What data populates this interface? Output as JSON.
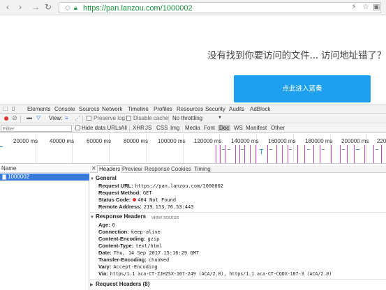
{
  "browser": {
    "url_scheme": "https://",
    "url_rest": "pan.lanzou.com/1000002",
    "icons": [
      "back-icon",
      "forward-icon",
      "reload-icon",
      "shield-icon",
      "lock-icon",
      "lightning-icon",
      "star-icon",
      "extension-icon"
    ]
  },
  "page": {
    "message": "没有找到你要访问的文件... 访问地址错了？",
    "enter_button": "点此进入蓝奏",
    "accent": "#1ea0ee"
  },
  "devtools": {
    "tabs": [
      "Elements",
      "Console",
      "Sources",
      "Network",
      "Timeline",
      "Profiles",
      "Resources",
      "Security",
      "Audits",
      "AdBlock"
    ],
    "toolbar": {
      "view_label": "View:",
      "preserve_log": "Preserve log",
      "disable_cache": "Disable cache",
      "throttling": "No throttling"
    },
    "filter": {
      "placeholder": "Filter",
      "hide_data_urls": "Hide data URLs",
      "types": [
        "All",
        "XHR",
        "JS",
        "CSS",
        "Img",
        "Media",
        "Font",
        "Doc",
        "WS",
        "Manifest",
        "Other"
      ],
      "active_type": "Doc"
    },
    "timeline_ticks": [
      "20000 ms",
      "40000 ms",
      "60000 ms",
      "80000 ms",
      "100000 ms",
      "120000 ms",
      "140000 ms",
      "160000 ms",
      "180000 ms",
      "200000 ms",
      "220"
    ],
    "requests": {
      "header": "Name",
      "items": [
        "1000002"
      ]
    },
    "detail_tabs": [
      "Headers",
      "Preview",
      "Response",
      "Cookies",
      "Timing"
    ],
    "general": {
      "title": "General",
      "request_url_k": "Request URL:",
      "request_url_v": "https://pan.lanzou.com/1000002",
      "method_k": "Request Method:",
      "method_v": "GET",
      "status_k": "Status Code:",
      "status_v": "404 Not Found",
      "remote_k": "Remote Address:",
      "remote_v": "219.153.76.53:443"
    },
    "response_headers": {
      "title": "Response Headers",
      "view_source": "view source",
      "age_k": "Age:",
      "age_v": "0",
      "conn_k": "Connection:",
      "conn_v": "keep-alive",
      "enc_k": "Content-Encoding:",
      "enc_v": "gzip",
      "type_k": "Content-Type:",
      "type_v": "text/html",
      "date_k": "Date:",
      "date_v": "Thu, 14 Sep 2017 15:16:29 GMT",
      "te_k": "Transfer-Encoding:",
      "te_v": "chunked",
      "vary_k": "Vary:",
      "vary_v": "Accept-Encoding",
      "via_k": "Via:",
      "via_v": "https/1.1 aca-CT-ZJHZSX-167-249 (ACA/2.0), https/1.1 aca-CT-CQDX-107-3 (ACA/2.0)"
    },
    "request_headers": {
      "title": "Request Headers (8)"
    }
  }
}
